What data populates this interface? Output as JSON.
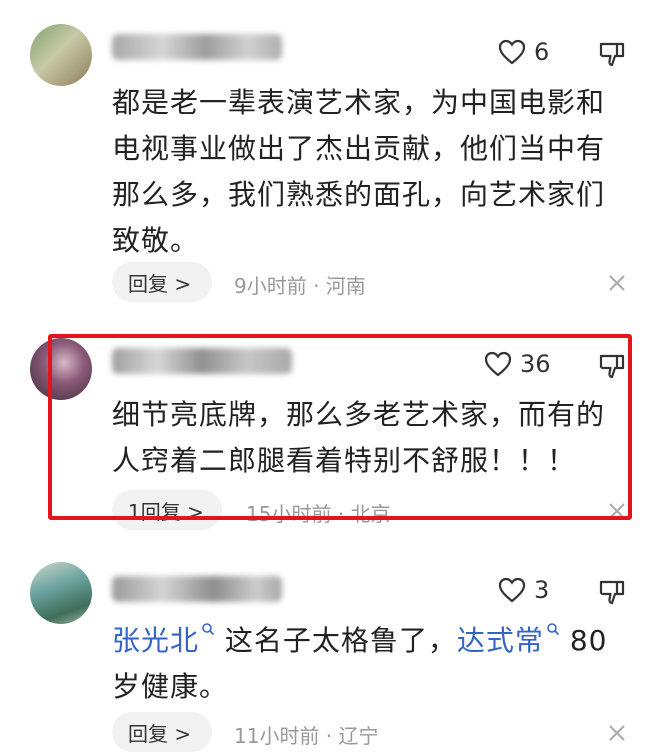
{
  "comments": [
    {
      "likes": "6",
      "text": "都是老一辈表演艺术家，为中国电影和电视事业做出了杰出贡献，他们当中有那么多，我们熟悉的面孔，向艺术家们致敬。",
      "reply_label": "回复 >",
      "meta": "9小时前 · 河南"
    },
    {
      "likes": "36",
      "text": "细节亮底牌，那么多老艺术家，而有的人窍着二郎腿看着特别不舒服！！！",
      "reply_label": "1回复 >",
      "meta": "15小时前 · 北京"
    },
    {
      "likes": "3",
      "mention1": "张光北",
      "mid_text": " 这名子太格鲁了，",
      "mention2": "达式常",
      "end_text": " 80岁健康。",
      "reply_label": "回复 >",
      "meta": "11小时前 · 辽宁"
    }
  ],
  "icons": {
    "like": "heart-outline-icon",
    "dislike": "thumbs-down-icon",
    "close": "close-icon",
    "search": "search-icon"
  },
  "colors": {
    "highlight": "#e3141b",
    "mention": "#3464c6"
  }
}
